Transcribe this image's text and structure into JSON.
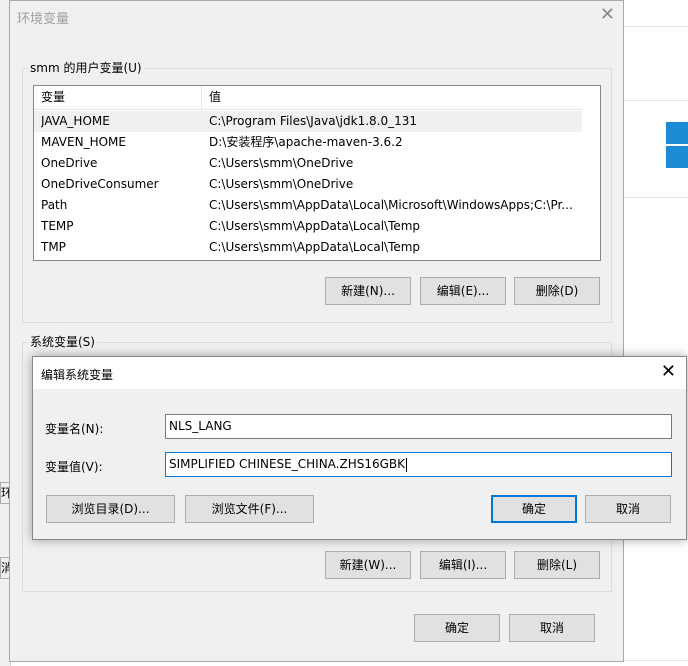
{
  "env_dialog": {
    "title": "环境变量",
    "user_group_label": "smm 的用户变量(U)",
    "columns": [
      "变量",
      "值"
    ],
    "user_vars": [
      {
        "name": "JAVA_HOME",
        "value": "C:\\Program Files\\Java\\jdk1.8.0_131"
      },
      {
        "name": "MAVEN_HOME",
        "value": "D:\\安装程序\\apache-maven-3.6.2"
      },
      {
        "name": "OneDrive",
        "value": "C:\\Users\\smm\\OneDrive"
      },
      {
        "name": "OneDriveConsumer",
        "value": "C:\\Users\\smm\\OneDrive"
      },
      {
        "name": "Path",
        "value": "C:\\Users\\smm\\AppData\\Local\\Microsoft\\WindowsApps;C:\\Pr..."
      },
      {
        "name": "TEMP",
        "value": "C:\\Users\\smm\\AppData\\Local\\Temp"
      },
      {
        "name": "TMP",
        "value": "C:\\Users\\smm\\AppData\\Local\\Temp"
      }
    ],
    "user_buttons": {
      "new": "新建(N)...",
      "edit": "编辑(E)...",
      "delete": "删除(D)"
    },
    "system_group_label": "系统变量(S)",
    "system_buttons": {
      "new": "新建(W)...",
      "edit": "编辑(I)...",
      "delete": "删除(L)"
    },
    "ok": "确定",
    "cancel": "取消"
  },
  "edit_dialog": {
    "title": "编辑系统变量",
    "name_label": "变量名(N):",
    "name_value": "NLS_LANG",
    "value_label": "变量值(V):",
    "value_value": "SIMPLIFIED CHINESE_CHINA.ZHS16GBK",
    "browse_dir": "浏览目录(D)...",
    "browse_file": "浏览文件(F)...",
    "ok": "确定",
    "cancel": "取消"
  },
  "background": {
    "left_fragments": [
      "环",
      "消"
    ],
    "windows_logo_color": "#1d8ad6"
  }
}
